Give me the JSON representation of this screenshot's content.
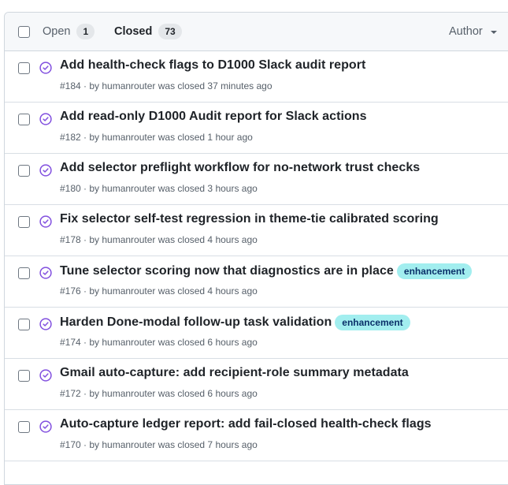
{
  "header": {
    "open_label": "Open",
    "open_count": "1",
    "closed_label": "Closed",
    "closed_count": "73",
    "author_label": "Author"
  },
  "issues": [
    {
      "title": "Add health-check flags to D1000 Slack audit report",
      "meta": "#184 · by humanrouter was closed 37 minutes ago",
      "label": ""
    },
    {
      "title": "Add read-only D1000 Audit report for Slack actions",
      "meta": "#182 · by humanrouter was closed 1 hour ago",
      "label": ""
    },
    {
      "title": "Add selector preflight workflow for no-network trust checks",
      "meta": "#180 · by humanrouter was closed 3 hours ago",
      "label": ""
    },
    {
      "title": "Fix selector self-test regression in theme-tie calibrated scoring",
      "meta": "#178 · by humanrouter was closed 4 hours ago",
      "label": ""
    },
    {
      "title": "Tune selector scoring now that diagnostics are in place",
      "meta": "#176 · by humanrouter was closed 4 hours ago",
      "label": "enhancement"
    },
    {
      "title": "Harden Done-modal follow-up task validation",
      "meta": "#174 · by humanrouter was closed 6 hours ago",
      "label": "enhancement"
    },
    {
      "title": "Gmail auto-capture: add recipient-role summary metadata",
      "meta": "#172 · by humanrouter was closed 6 hours ago",
      "label": ""
    },
    {
      "title": "Auto-capture ledger report: add fail-closed health-check flags",
      "meta": "#170 · by humanrouter was closed 7 hours ago",
      "label": ""
    }
  ],
  "colors": {
    "closed_icon": "#8250df",
    "label_bg": "#a2eeef",
    "label_text": "#0a3069"
  },
  "icons": {
    "status": "check-circle-icon",
    "dropdown": "caret-down-icon"
  }
}
